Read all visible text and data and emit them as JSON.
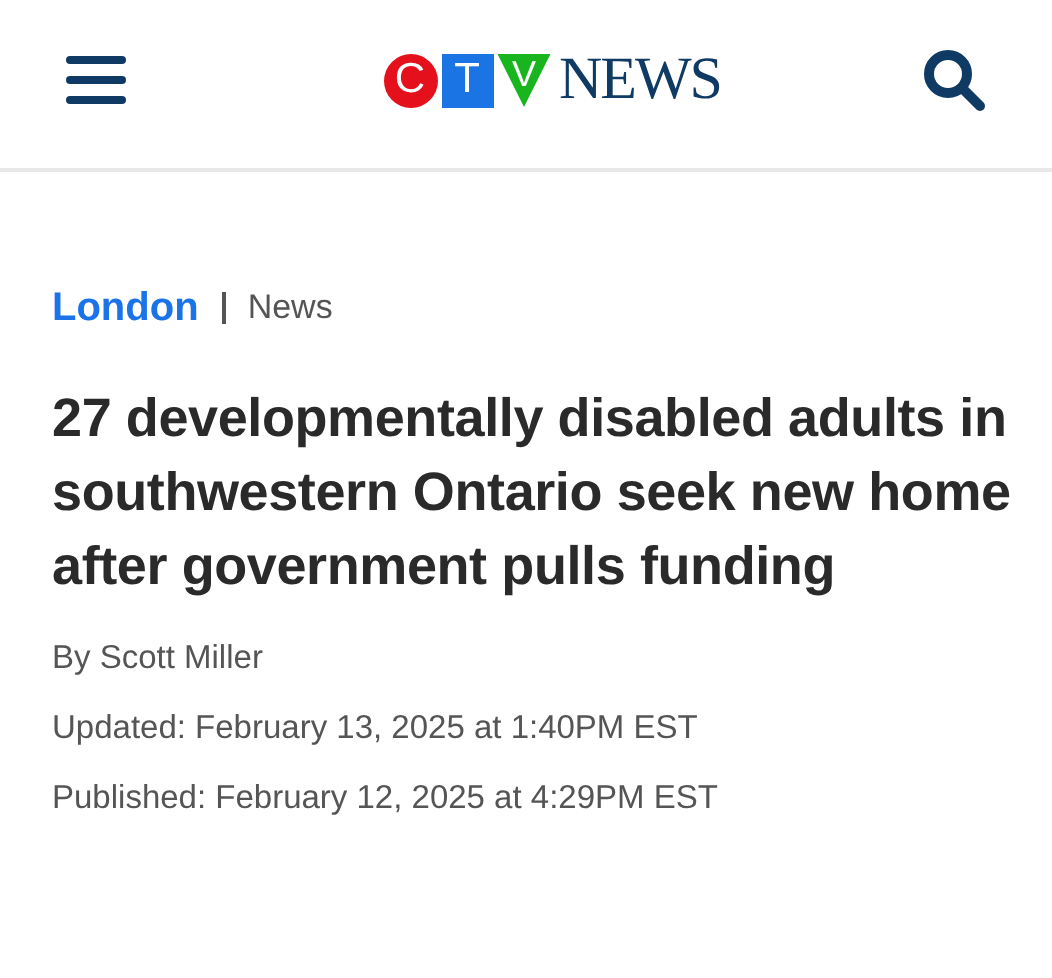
{
  "header": {
    "logo": {
      "letters": [
        "C",
        "T",
        "V"
      ],
      "wordmark": "NEWS"
    }
  },
  "breadcrumb": {
    "section": "London",
    "category": "News"
  },
  "headline": "27 developmentally disabled adults in southwestern Ontario seek new home after government pulls funding",
  "byline": "By Scott Miller",
  "updated": "Updated: February 13, 2025 at 1:40PM EST",
  "published": "Published: February 12, 2025 at 4:29PM EST"
}
